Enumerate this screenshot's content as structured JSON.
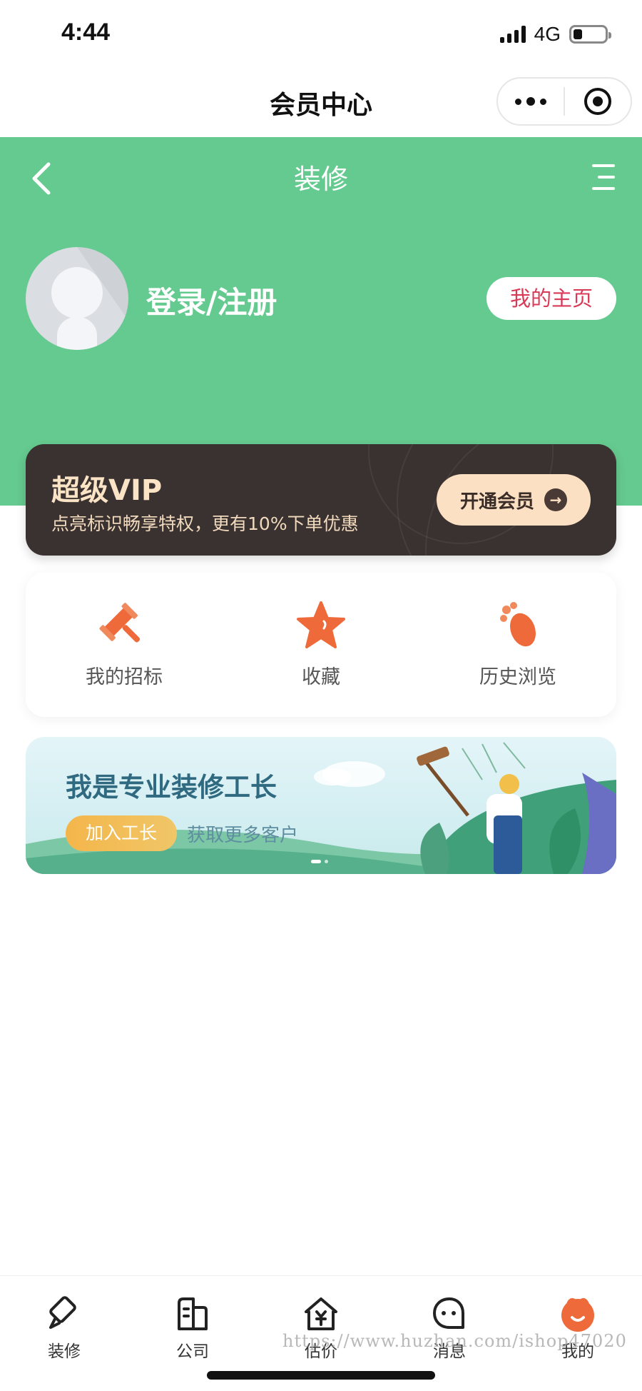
{
  "status_bar": {
    "time": "4:44",
    "network": "4G"
  },
  "mini_program": {
    "title": "会员中心"
  },
  "nav": {
    "title": "装修"
  },
  "profile": {
    "login_text": "登录/注册",
    "homepage_button": "我的主页"
  },
  "vip": {
    "title": "超级VIP",
    "subtitle": "点亮标识畅享特权，更有10%下单优惠",
    "button_label": "开通会员"
  },
  "quick_actions": [
    {
      "label": "我的招标",
      "icon": "gavel-icon"
    },
    {
      "label": "收藏",
      "icon": "star-icon"
    },
    {
      "label": "历史浏览",
      "icon": "footprint-icon"
    }
  ],
  "banner": {
    "title": "我是专业装修工长",
    "tag": "加入工长",
    "subtitle": "获取更多客户"
  },
  "tabbar": [
    {
      "label": "装修",
      "icon": "brush-icon",
      "active": false
    },
    {
      "label": "公司",
      "icon": "building-icon",
      "active": false
    },
    {
      "label": "估价",
      "icon": "price-house-icon",
      "active": false
    },
    {
      "label": "消息",
      "icon": "message-icon",
      "active": false
    },
    {
      "label": "我的",
      "icon": "profile-icon",
      "active": true
    }
  ],
  "watermark": "https://www.huzhan.com/ishop47020",
  "colors": {
    "primary_green": "#65ca8f",
    "vip_dark": "#3a3230",
    "vip_gold": "#fbe0c3",
    "accent_orange": "#ee6a3a",
    "homepage_red": "#d93a57"
  }
}
